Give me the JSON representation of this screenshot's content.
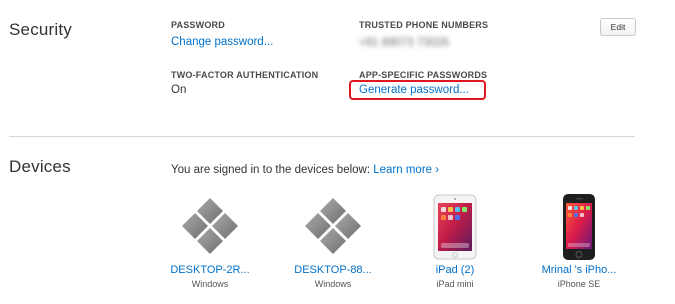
{
  "security": {
    "title": "Security",
    "password_label": "PASSWORD",
    "password_link": "Change password...",
    "trusted_label": "TRUSTED PHONE NUMBERS",
    "trusted_value": "+91 89073 73026",
    "edit_label": "Edit",
    "twofactor_label": "TWO-FACTOR AUTHENTICATION",
    "twofactor_value": "On",
    "appspecific_label": "APP-SPECIFIC PASSWORDS",
    "appspecific_link": "Generate password...",
    "highlight_color": "#e01822"
  },
  "devices": {
    "title": "Devices",
    "intro_text": "You are signed in to the devices below: ",
    "learn_more": "Learn more ›",
    "items": [
      {
        "name": "DESKTOP-2R...",
        "model": "Windows",
        "icon": "windows-pc-icon"
      },
      {
        "name": "DESKTOP-88...",
        "model": "Windows",
        "icon": "windows-pc-icon"
      },
      {
        "name": "iPad (2)",
        "model": "iPad mini",
        "icon": "ipad-icon"
      },
      {
        "name": "Mrinal 's iPho...",
        "model": "iPhone SE",
        "icon": "iphone-icon"
      }
    ]
  },
  "colors": {
    "link": "#0070c9",
    "text": "#333333",
    "divider": "#d6d6d6"
  }
}
